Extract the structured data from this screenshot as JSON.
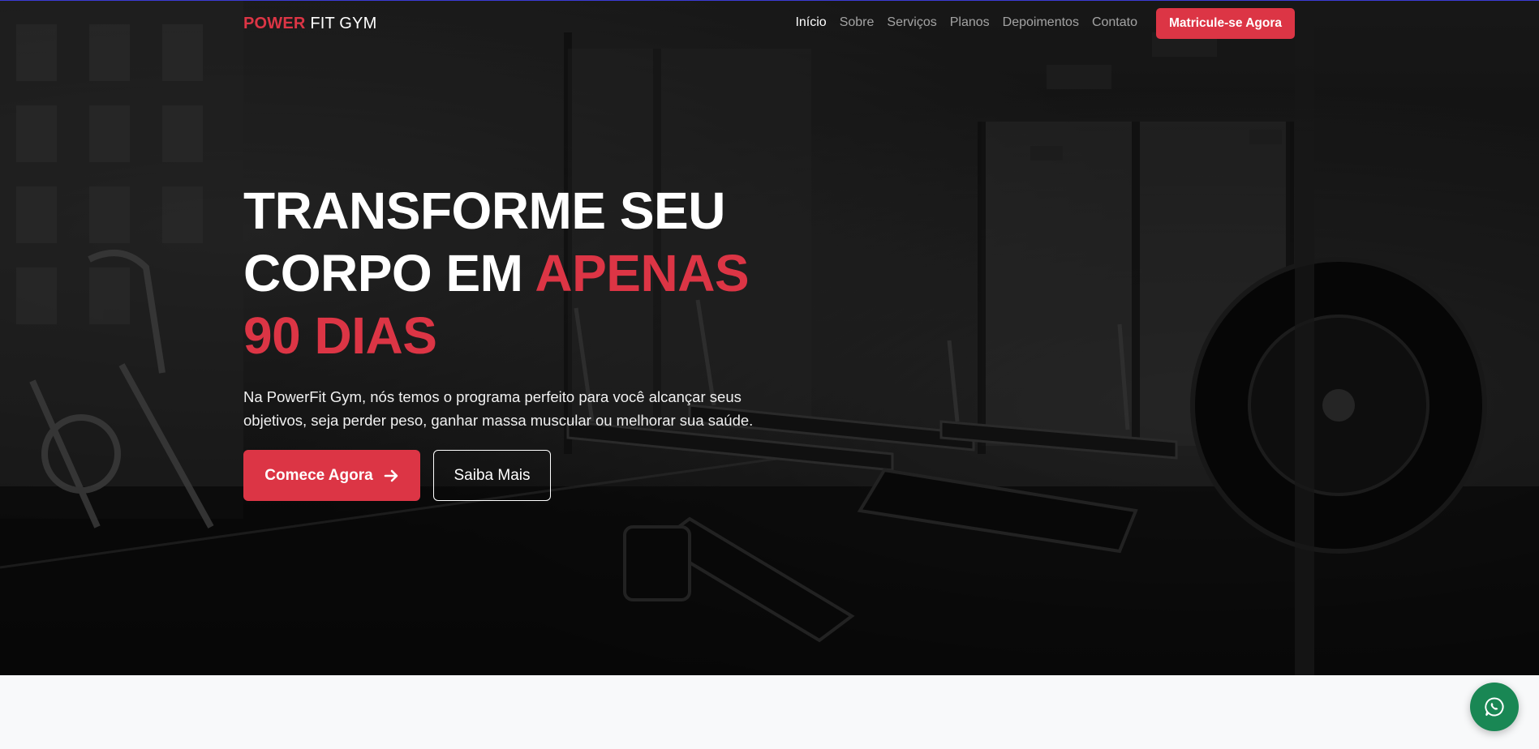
{
  "brand": {
    "part1": "POWER",
    "part2": " FIT GYM"
  },
  "nav": {
    "links": [
      "Início",
      "Sobre",
      "Serviços",
      "Planos",
      "Depoimentos",
      "Contato"
    ],
    "active_index": 0,
    "cta_label": "Matricule-se Agora"
  },
  "hero": {
    "title_line1": "TRANSFORME SEU",
    "title_line2_white": "CORPO EM ",
    "title_line2_accent": "APENAS",
    "title_line3_accent": "90 DIAS",
    "subtitle": "Na PowerFit Gym, nós temos o programa perfeito para você alcançar seus objetivos, seja perder peso, ganhar massa muscular ou melhorar sua saúde.",
    "primary_button": "Comece Agora",
    "secondary_button": "Saiba Mais"
  },
  "icons": {
    "arrow": "arrow-right-icon",
    "whatsapp": "whatsapp-icon"
  },
  "colors": {
    "accent": "#dc3545",
    "whatsapp": "#198754",
    "section_bg": "#f8f9fa"
  }
}
